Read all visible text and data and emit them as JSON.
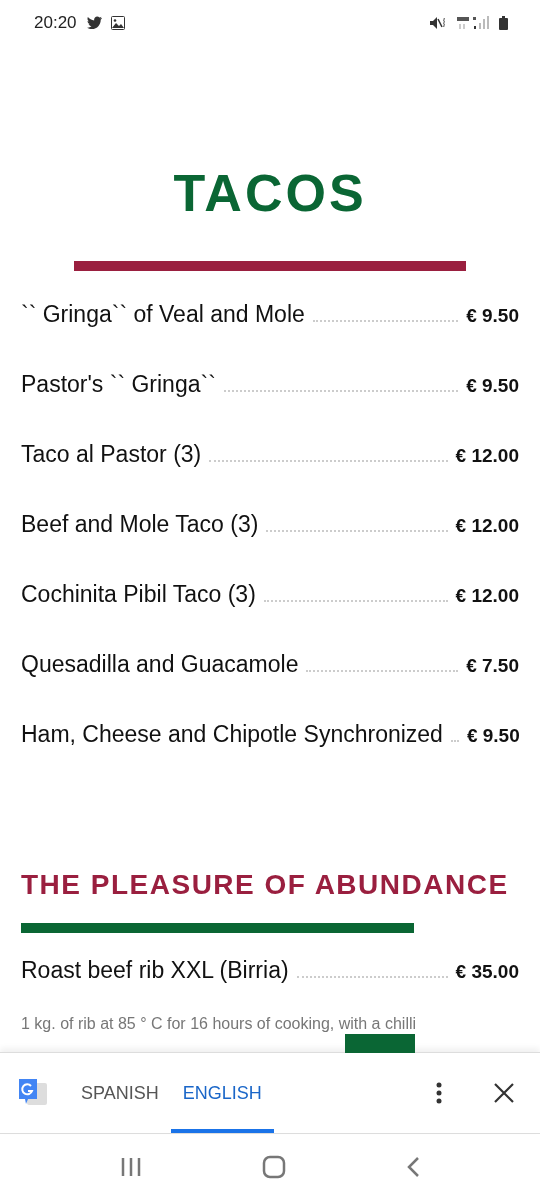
{
  "status_bar": {
    "time": "20:20"
  },
  "sections": [
    {
      "title": "TACOS",
      "color": "#0a6634",
      "items": [
        {
          "name": "`` Gringa`` of Veal and Mole",
          "price": "€ 9.50"
        },
        {
          "name": "Pastor's `` Gringa``",
          "price": "€ 9.50"
        },
        {
          "name": "Taco al Pastor (3)",
          "price": "€ 12.00"
        },
        {
          "name": "Beef and Mole Taco (3)",
          "price": "€ 12.00"
        },
        {
          "name": "Cochinita Pibil Taco (3)",
          "price": "€ 12.00"
        },
        {
          "name": "Quesadilla and Guacamole",
          "price": "€ 7.50"
        },
        {
          "name": "Ham, Cheese and Chipotle Synchronized",
          "price": "€ 9.50"
        }
      ]
    },
    {
      "title": "THE PLEASURE OF ABUNDANCE",
      "color": "#9a1f3f",
      "items": [
        {
          "name": "Roast beef rib XXL (Birria)",
          "price": "€ 35.00",
          "description": "1 kg. of rib at 85 ° C for 16 hours of cooking, with a chilli"
        }
      ]
    }
  ],
  "translate_bar": {
    "languages": [
      {
        "label": "SPANISH",
        "selected": false
      },
      {
        "label": "ENGLISH",
        "selected": true
      }
    ]
  }
}
